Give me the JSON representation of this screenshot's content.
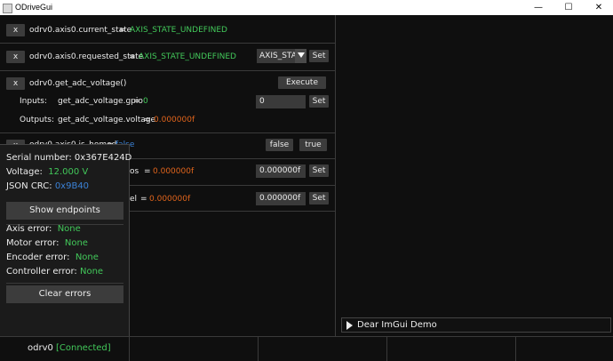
{
  "window": {
    "title": "ODriveGui",
    "minimize_glyph": "—",
    "maximize_glyph": "☐",
    "close_glyph": "✕"
  },
  "rows": {
    "current_state": {
      "x_label": "x",
      "name": "odrv0.axis0.current_state",
      "eq": "=",
      "value": "AXIS_STATE_UNDEFINED"
    },
    "requested_state": {
      "x_label": "x",
      "name": "odrv0.axis0.requested_state",
      "eq": "=",
      "value": "AXIS_STATE_UNDEFINED",
      "combo_value": "AXIS_STAT",
      "set_label": "Set"
    },
    "get_adc_voltage": {
      "x_label": "x",
      "name": "odrv0.get_adc_voltage()",
      "execute_label": "Execute",
      "inputs_label": "Inputs:",
      "input_name": "get_adc_voltage.gpio",
      "eq": "=",
      "input_value": "0",
      "input_field": "0",
      "set_label": "Set",
      "outputs_label": "Outputs:",
      "output_name": "get_adc_voltage.voltage",
      "output_value": "0.000000f"
    },
    "is_homed": {
      "x_label": "x",
      "name": "odrv0.axis0.is_homed",
      "eq": "=",
      "value": "false",
      "false_label": "false",
      "true_label": "true"
    },
    "row5": {
      "name_partial": "os",
      "eq": "=",
      "value": "0.000000f",
      "field": "0.000000f",
      "set_label": "Set"
    },
    "row6": {
      "name_partial": "el",
      "eq": "=",
      "value": "0.000000f",
      "field": "0.000000f",
      "set_label": "Set"
    }
  },
  "popup": {
    "serial_label": "Serial number:",
    "serial_value": "0x367E424D",
    "voltage_label": "Voltage:",
    "voltage_value": "12.000 V",
    "crc_label": "JSON CRC:",
    "crc_value": "0x9B40",
    "show_endpoints_label": "Show endpoints",
    "axis_error_label": "Axis error:",
    "axis_error_value": "None",
    "motor_error_label": "Motor error:",
    "motor_error_value": "None",
    "encoder_error_label": "Encoder error:",
    "encoder_error_value": "None",
    "controller_error_label": "Controller error:",
    "controller_error_value": "None",
    "clear_errors_label": "Clear errors"
  },
  "demo": {
    "label": "Dear ImGui Demo"
  },
  "status": {
    "device": "odrv0",
    "connection": "[Connected]"
  },
  "colors": {
    "value_green": "#42c85a",
    "value_blue": "#3b82d6",
    "value_orange": "#e0641c",
    "button": "#3c3c3c"
  }
}
